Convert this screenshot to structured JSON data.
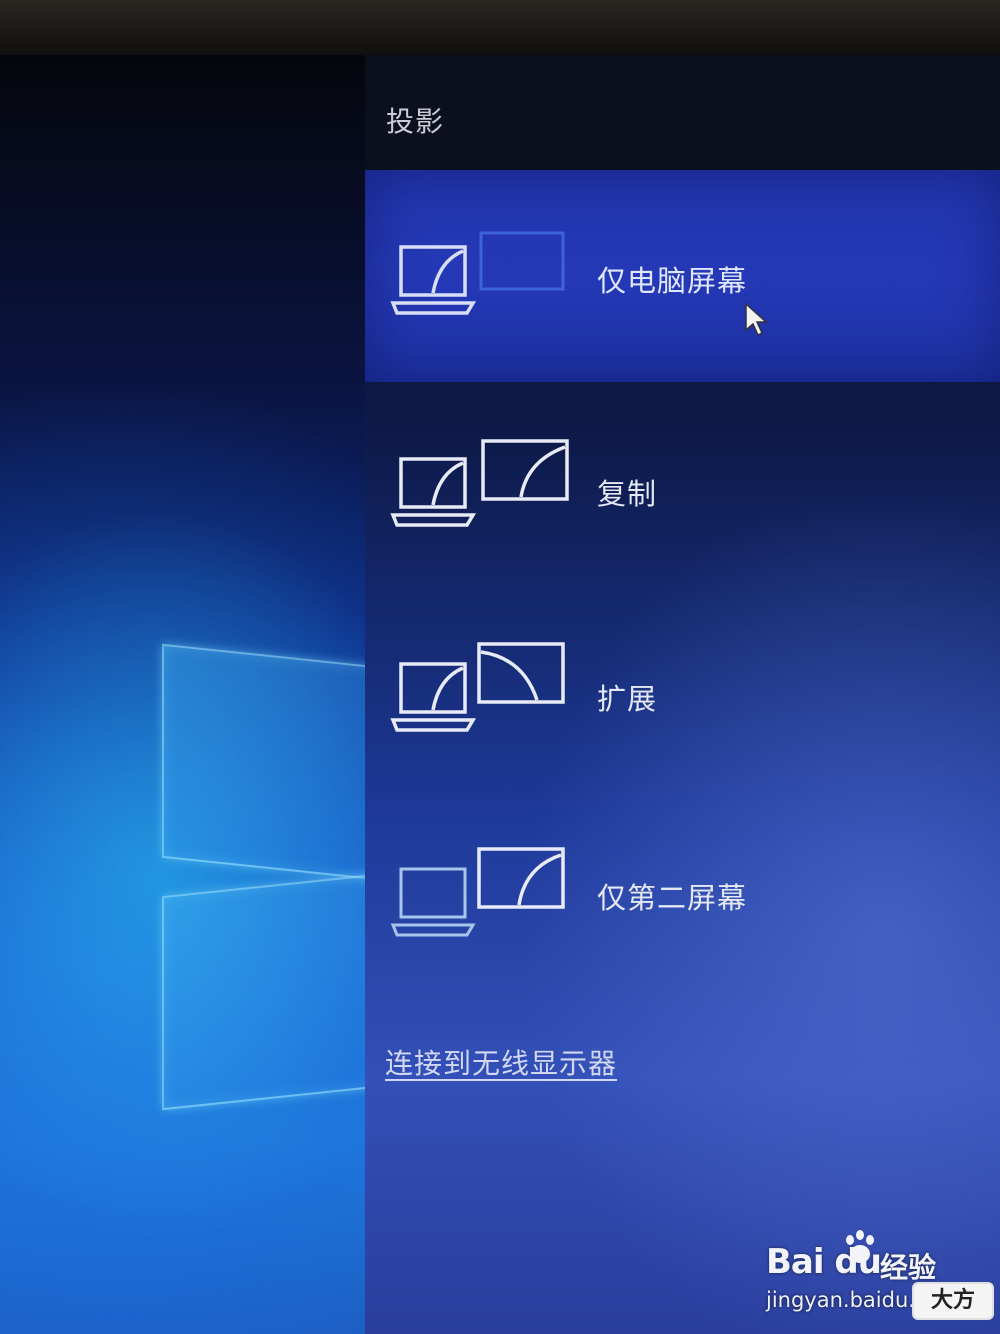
{
  "panel": {
    "title": "投影",
    "options": [
      {
        "label": "仅电脑屏幕",
        "icon": "pc-screen-only-icon",
        "selected": true
      },
      {
        "label": "复制",
        "icon": "duplicate-icon",
        "selected": false
      },
      {
        "label": "扩展",
        "icon": "extend-icon",
        "selected": false
      },
      {
        "label": "仅第二屏幕",
        "icon": "second-screen-only-icon",
        "selected": false
      }
    ],
    "wireless_link": "连接到无线显示器"
  },
  "watermark": {
    "brand": "Bai du",
    "sub": "经验",
    "url": "jingyan.baidu.com",
    "badge": "大方"
  },
  "colors": {
    "selected_bg": "#2236b0",
    "panel_text": "#e4e8f4",
    "header_bg": "#0c0f1c"
  }
}
